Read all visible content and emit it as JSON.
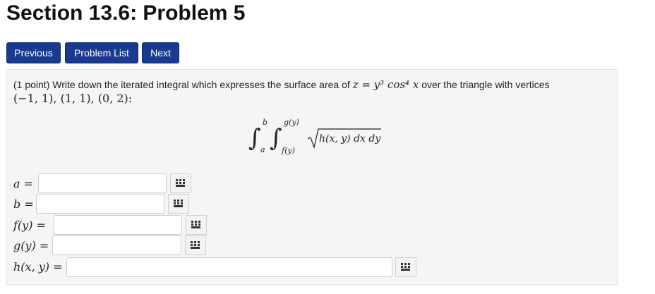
{
  "page": {
    "title": "Section 13.6: Problem 5"
  },
  "nav": {
    "previous_label": "Previous",
    "problem_list_label": "Problem List",
    "next_label": "Next"
  },
  "problem": {
    "points": "(1 point) Write down the iterated integral which expresses the surface area of",
    "function_text": "z = y³ cos⁴ x",
    "over_text": "over the triangle with vertices",
    "vertices": "(−1, 1), (1, 1), (0, 2):",
    "integral": {
      "lower_outer": "a",
      "upper_outer": "b",
      "lower_inner": "f(y)",
      "upper_inner": "g(y)",
      "integrand": "h(x, y) dx dy"
    }
  },
  "answers": [
    {
      "label": "a =",
      "value": ""
    },
    {
      "label": "b =",
      "value": ""
    },
    {
      "label": "f(y) =",
      "value": ""
    },
    {
      "label": "g(y) =",
      "value": ""
    },
    {
      "label": "h(x, y) =",
      "value": ""
    }
  ],
  "colors": {
    "button": "#1a3a8f",
    "panel": "#f5f5f5"
  },
  "icons": {
    "equation_editor": "keyboard-grid-icon"
  }
}
